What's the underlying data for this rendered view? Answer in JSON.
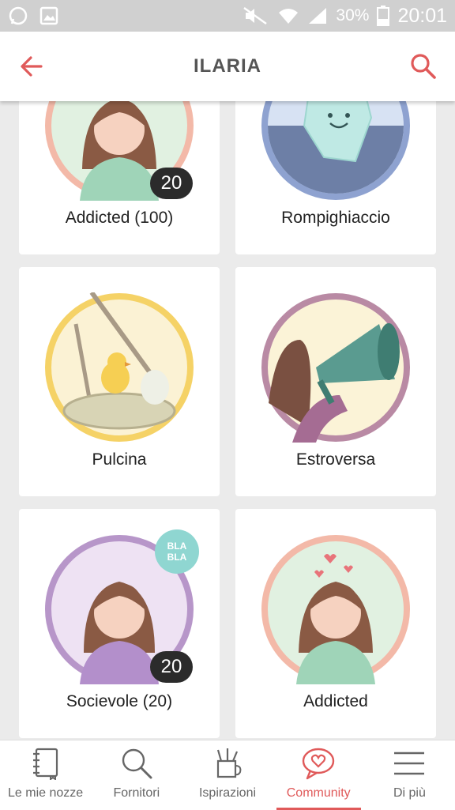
{
  "status_bar": {
    "battery": "30%",
    "time": "20:01"
  },
  "header": {
    "title": "ILARIA",
    "back_icon": "arrow-left-icon",
    "search_icon": "search-icon"
  },
  "colors": {
    "accent": "#e05a5a"
  },
  "badges": [
    {
      "label": "Addicted (100)",
      "count": "20",
      "ring": "#f3b9a8"
    },
    {
      "label": "Rompighiaccio",
      "ring": "#8ea2d0"
    },
    {
      "label": "Pulcina",
      "ring": "#f5d266"
    },
    {
      "label": "Estroversa",
      "ring": "#b98aa4"
    },
    {
      "label": "Socievole (20)",
      "count": "20",
      "bubble": [
        "BLA",
        "BLA"
      ],
      "ring": "#b796c9"
    },
    {
      "label": "Addicted",
      "ring": "#f3b9a8"
    }
  ],
  "bottom_nav": [
    {
      "label": "Le mie nozze",
      "icon": "notebook-icon"
    },
    {
      "label": "Fornitori",
      "icon": "search-icon"
    },
    {
      "label": "Ispirazioni",
      "icon": "pencil-cup-icon"
    },
    {
      "label": "Community",
      "icon": "heart-chat-icon",
      "active": true
    },
    {
      "label": "Di più",
      "icon": "menu-icon"
    }
  ]
}
